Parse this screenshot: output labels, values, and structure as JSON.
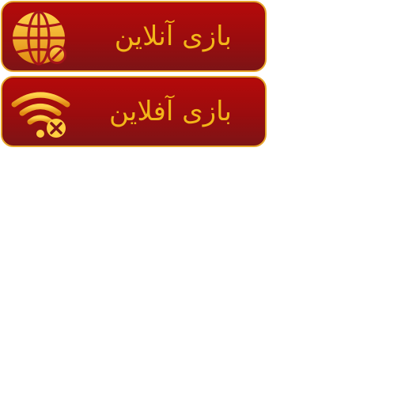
{
  "buttons": {
    "online": {
      "label": "بازی آنلاین",
      "icon": "globe-icon"
    },
    "offline": {
      "label": "بازی آفلاین",
      "icon": "wifi-off-icon"
    }
  },
  "colors": {
    "button_red": "#9a0c0e",
    "gold": "#f2b619",
    "border_gold": "#e8a62c"
  }
}
